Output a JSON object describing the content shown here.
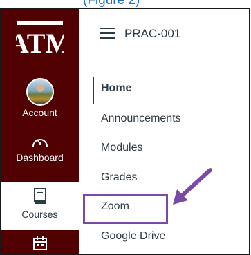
{
  "caption": "(Figure 2)",
  "global_nav": {
    "logo_text": "ATM",
    "items": [
      {
        "label": "Account",
        "icon": "avatar"
      },
      {
        "label": "Dashboard",
        "icon": "dashboard-icon"
      },
      {
        "label": "Courses",
        "icon": "courses-icon"
      },
      {
        "label": "",
        "icon": "calendar-icon"
      }
    ]
  },
  "header": {
    "course_code": "PRAC-001"
  },
  "course_nav": {
    "items": [
      "Home",
      "Announcements",
      "Modules",
      "Grades",
      "Zoom",
      "Google Drive"
    ],
    "active": "Home",
    "highlighted": "Zoom"
  },
  "colors": {
    "global_nav_bg": "#500000",
    "highlight_border": "#7a4aa6",
    "arrow": "#7a4aa6",
    "text": "#2d3b45",
    "caption": "#1a6fd1"
  }
}
